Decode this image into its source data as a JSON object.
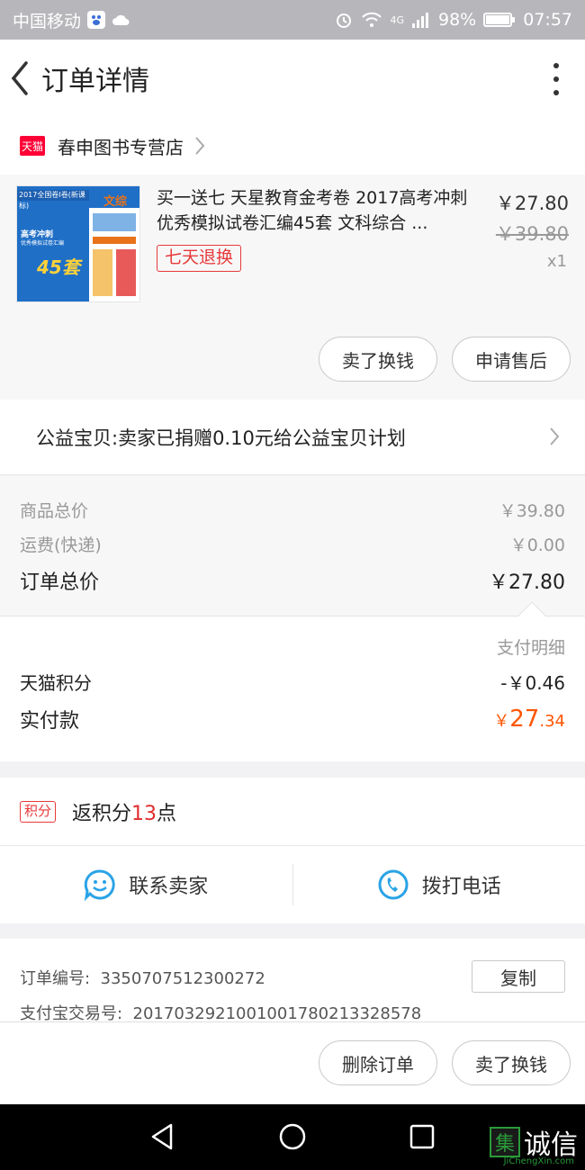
{
  "status_bar": {
    "carrier": "中国移动",
    "network": "4G",
    "battery": "98%",
    "time": "07:57"
  },
  "header": {
    "title": "订单详情"
  },
  "store": {
    "badge": "天猫",
    "name": "春申图书专营店"
  },
  "product": {
    "title": "买一送七 天星教育金考卷 2017高考冲刺优秀模拟试卷汇编45套 文科综合 ...",
    "tag": "七天退换",
    "price": "￥27.80",
    "original_price": "￥39.80",
    "quantity": "x1",
    "cover": {
      "top_banner": "2017全国卷Ⅰ卷(新课标)",
      "subject": "文综",
      "line1": "高考冲刺",
      "line2": "优秀模拟试卷汇编",
      "big": "45套"
    },
    "actions": [
      "卖了换钱",
      "申请售后"
    ]
  },
  "charity": {
    "text": "公益宝贝:卖家已捐赠0.10元给公益宝贝计划"
  },
  "summary": {
    "goods_total_label": "商品总价",
    "goods_total_value": "￥39.80",
    "shipping_label": "运费(快递)",
    "shipping_value": "￥0.00",
    "order_total_label": "订单总价",
    "order_total_value": "￥27.80"
  },
  "payment": {
    "detail_link": "支付明细",
    "points_label": "天猫积分",
    "points_value": "-￥0.46",
    "paid_label": "实付款",
    "paid_currency": "￥",
    "paid_int": "27",
    "paid_dec": ".34"
  },
  "rebate": {
    "badge": "积分",
    "prefix": "返积分",
    "number": "13",
    "suffix": "点"
  },
  "contact": {
    "seller": "联系卖家",
    "phone": "拨打电话"
  },
  "order_info": {
    "order_no_label": "订单编号:",
    "order_no": "3350707512300272",
    "copy": "复制",
    "alipay_label": "支付宝交易号:",
    "alipay_no": "2017032921001001780213328578"
  },
  "bottom_actions": [
    "删除订单",
    "卖了换钱"
  ],
  "watermark": {
    "logo_char": "集",
    "text": "诚信",
    "sub": "JiChengXin.com"
  },
  "colors": {
    "accent_red": "#e83a3a",
    "price_orange": "#ff5500",
    "tmall_red": "#ff0036",
    "icon_blue": "#2aa3e6"
  }
}
